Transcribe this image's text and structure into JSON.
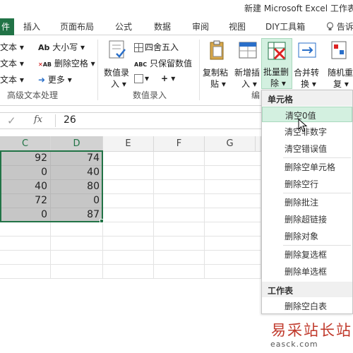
{
  "window": {
    "title": "新建 Microsoft Excel 工作表"
  },
  "tabs": [
    {
      "label": "件"
    },
    {
      "label": "插入"
    },
    {
      "label": "页面布局"
    },
    {
      "label": "公式"
    },
    {
      "label": "数据"
    },
    {
      "label": "审阅"
    },
    {
      "label": "视图"
    },
    {
      "label": "DIY工具箱"
    },
    {
      "label": "告诉"
    }
  ],
  "ribbon": {
    "text_group": {
      "items": [
        "文本",
        "文本",
        "文本"
      ],
      "case_label": "大小写",
      "case_icon_text": "Ab",
      "delete_spaces_label": "删除空格",
      "delete_spaces_icon_text": "AB",
      "more_label": "更多",
      "group_label": "高级文本处理"
    },
    "number_group": {
      "big_button_line1": "数值录",
      "big_button_line2": "入",
      "round_label": "四舍五入",
      "keep_value_label": "只保留数值",
      "keep_value_icon_text": "ABC",
      "plus_label": "+",
      "group_label": "数值录入"
    },
    "edit_group": {
      "copy_line1": "复制粘",
      "copy_line2": "贴",
      "insert_line1": "新增插",
      "insert_line2": "入",
      "batch_delete_line1": "批量删",
      "batch_delete_line2": "除",
      "merge_line1": "合并转",
      "merge_line2": "换",
      "random_line1": "随机重",
      "random_line2": "复",
      "group_label": "编"
    }
  },
  "formula_bar": {
    "cancel": "✓",
    "fx": "fx",
    "value": "26"
  },
  "columns": [
    "C",
    "D",
    "E",
    "F",
    "G"
  ],
  "rows": [
    {
      "c": "92",
      "d": "74"
    },
    {
      "c": "0",
      "d": "40"
    },
    {
      "c": "40",
      "d": "80"
    },
    {
      "c": "72",
      "d": "0"
    },
    {
      "c": "0",
      "d": "87"
    }
  ],
  "menu": {
    "cell_header": "单元格",
    "items_cell": [
      "清空0值",
      "清空非数字",
      "清空错误值",
      "删除空单元格",
      "删除空行",
      "删除批注",
      "删除超链接",
      "删除对象",
      "删除复选框",
      "删除单选框"
    ],
    "sheet_header": "工作表",
    "items_sheet": [
      "删除空白表"
    ]
  },
  "watermark": {
    "text": "易采站长站",
    "url": "easck.com"
  },
  "colors": {
    "excel_green": "#217346",
    "highlight": "#d3f0e0",
    "selected_cell": "#c6c6c6"
  }
}
